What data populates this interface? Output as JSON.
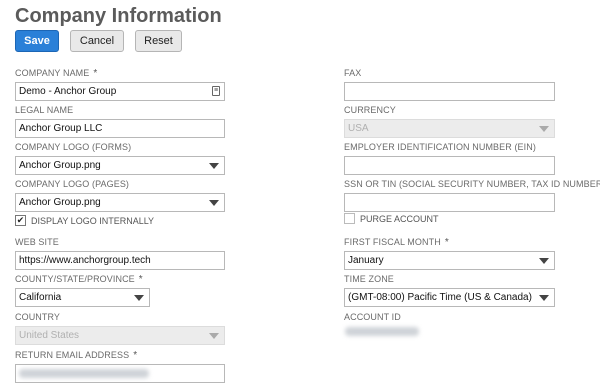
{
  "page": {
    "title": "Company Information"
  },
  "toolbar": {
    "save_label": "Save",
    "cancel_label": "Cancel",
    "reset_label": "Reset"
  },
  "left": {
    "company_name": {
      "label": "COMPANY NAME",
      "required": "*",
      "value": "Demo - Anchor Group"
    },
    "legal_name": {
      "label": "LEGAL NAME",
      "value": "Anchor Group LLC"
    },
    "logo_forms": {
      "label": "COMPANY LOGO (FORMS)",
      "value": "Anchor Group.png"
    },
    "logo_pages": {
      "label": "COMPANY LOGO (PAGES)",
      "value": "Anchor Group.png"
    },
    "display_logo": {
      "label": "DISPLAY LOGO INTERNALLY",
      "checked": true,
      "mark": "✔"
    },
    "web_site": {
      "label": "WEB SITE",
      "value": "https://www.anchorgroup.tech"
    },
    "county": {
      "label": "COUNTY/STATE/PROVINCE",
      "required": "*",
      "value": "California"
    },
    "country": {
      "label": "COUNTRY",
      "value": "United States"
    },
    "return_email": {
      "label": "RETURN EMAIL ADDRESS",
      "required": "*"
    }
  },
  "right": {
    "fax": {
      "label": "FAX",
      "value": ""
    },
    "currency": {
      "label": "CURRENCY",
      "value": "USA"
    },
    "ein": {
      "label": "EMPLOYER IDENTIFICATION NUMBER (EIN)",
      "value": ""
    },
    "ssn": {
      "label": "SSN OR TIN (SOCIAL SECURITY NUMBER, TAX ID NUMBER)",
      "value": ""
    },
    "purge_account": {
      "label": "PURGE ACCOUNT",
      "checked": false
    },
    "first_fiscal_month": {
      "label": "FIRST FISCAL MONTH",
      "required": "*",
      "value": "January"
    },
    "time_zone": {
      "label": "TIME ZONE",
      "value": "(GMT-08:00) Pacific Time (US & Canada)"
    },
    "account_id": {
      "label": "ACCOUNT ID"
    }
  },
  "icons": {
    "field_help": "list-icon",
    "dropdown": "chevron-down-icon",
    "checkmark": "checkmark-icon"
  }
}
